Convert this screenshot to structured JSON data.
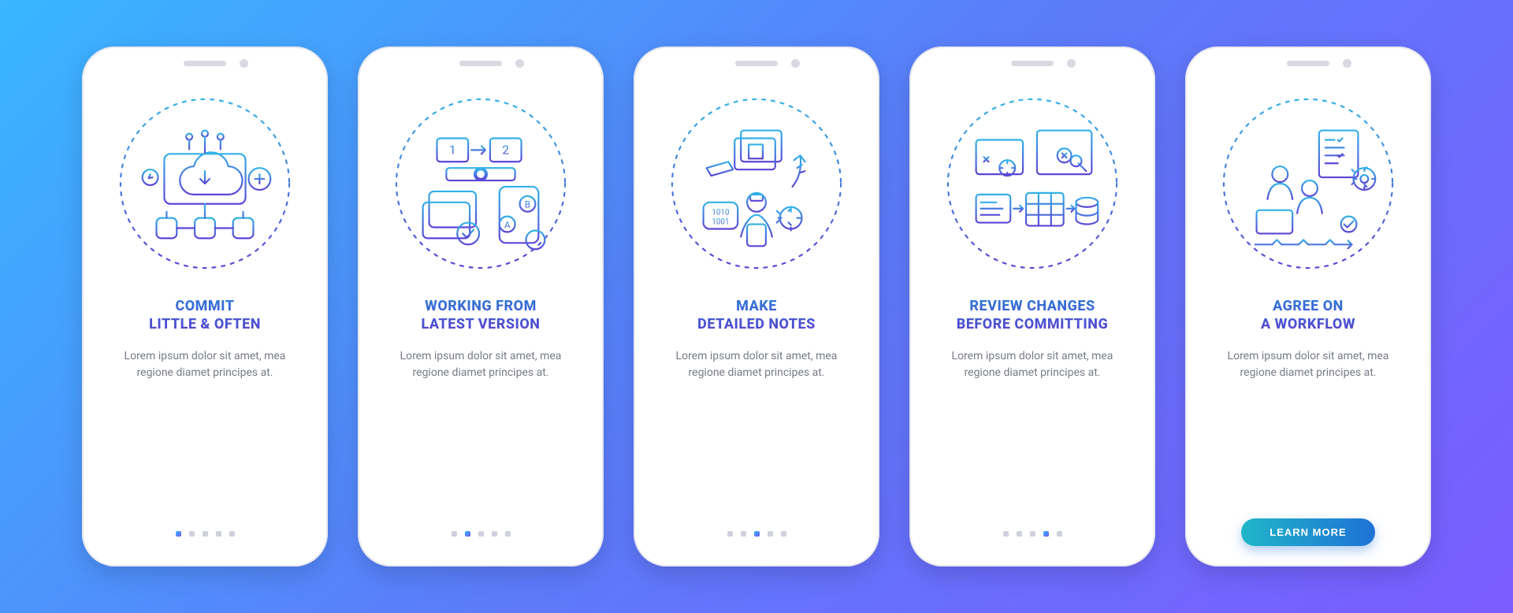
{
  "screens": [
    {
      "id": "commit",
      "title": "COMMIT\nLITTLE & OFTEN",
      "desc": "Lorem ipsum dolor sit amet, mea regione diamet principes at.",
      "active_dot": 0,
      "icon": "cloud-boxes-icon"
    },
    {
      "id": "latest",
      "title": "WORKING FROM\nLATEST VERSION",
      "desc": "Lorem ipsum dolor sit amet, mea regione diamet principes at.",
      "active_dot": 1,
      "icon": "ab-test-icon"
    },
    {
      "id": "notes",
      "title": "MAKE\nDETAILED NOTES",
      "desc": "Lorem ipsum dolor sit amet, mea regione diamet principes at.",
      "active_dot": 2,
      "icon": "coder-notes-icon"
    },
    {
      "id": "review",
      "title": "REVIEW CHANGES\nBEFORE COMMITTING",
      "desc": "Lorem ipsum dolor sit amet, mea regione diamet principes at.",
      "active_dot": 3,
      "icon": "review-db-icon"
    },
    {
      "id": "workflow",
      "title": "AGREE ON\nA WORKFLOW",
      "desc": "Lorem ipsum dolor sit amet, mea regione diamet principes at.",
      "active_dot": 4,
      "icon": "team-workflow-icon",
      "cta": "LEARN MORE"
    }
  ],
  "dot_count": 5
}
